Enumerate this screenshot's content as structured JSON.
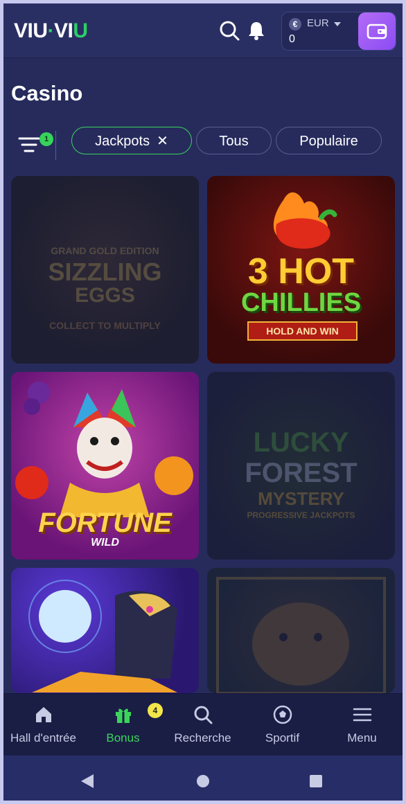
{
  "header": {
    "logo_left": "VIU",
    "logo_right": "VI",
    "logo_u": "U",
    "currency_symbol": "€",
    "currency": "EUR",
    "balance": "0"
  },
  "page": {
    "title": "Casino"
  },
  "filters": {
    "badge_count": "1",
    "chips": [
      {
        "label": "Jackpots",
        "active": true
      },
      {
        "label": "Tous",
        "active": false
      },
      {
        "label": "Populaire",
        "active": false
      }
    ]
  },
  "games": [
    {
      "line1": "GRAND GOLD EDITION",
      "line2": "SIZZLING",
      "line3": "EGGS",
      "line4": "COLLECT TO MULTIPLY",
      "dimmed": true
    },
    {
      "line1": "3 HOT",
      "line2": "CHILLIES",
      "line3": "HOLD AND WIN",
      "dimmed": false
    },
    {
      "line1": "FORTUNE",
      "line2": "WILD",
      "dimmed": false
    },
    {
      "line1": "LUCKY",
      "line2": "FOREST",
      "line3": "MYSTERY",
      "line4": "PROGRESSIVE JACKPOTS",
      "dimmed": true
    },
    {
      "dimmed": false
    },
    {
      "dimmed": true
    }
  ],
  "nav": {
    "items": [
      {
        "label": "Hall d'entrée",
        "icon": "home-icon"
      },
      {
        "label": "Bonus",
        "icon": "gift-icon",
        "active": true,
        "badge": "4"
      },
      {
        "label": "Recherche",
        "icon": "search-icon"
      },
      {
        "label": "Sportif",
        "icon": "soccer-ball-icon"
      },
      {
        "label": "Menu",
        "icon": "menu-icon"
      }
    ]
  },
  "colors": {
    "background": "#262b5c",
    "accent_green": "#3cd45c",
    "wallet_purple": "#9b5cf5",
    "badge_yellow": "#f2e64a"
  }
}
